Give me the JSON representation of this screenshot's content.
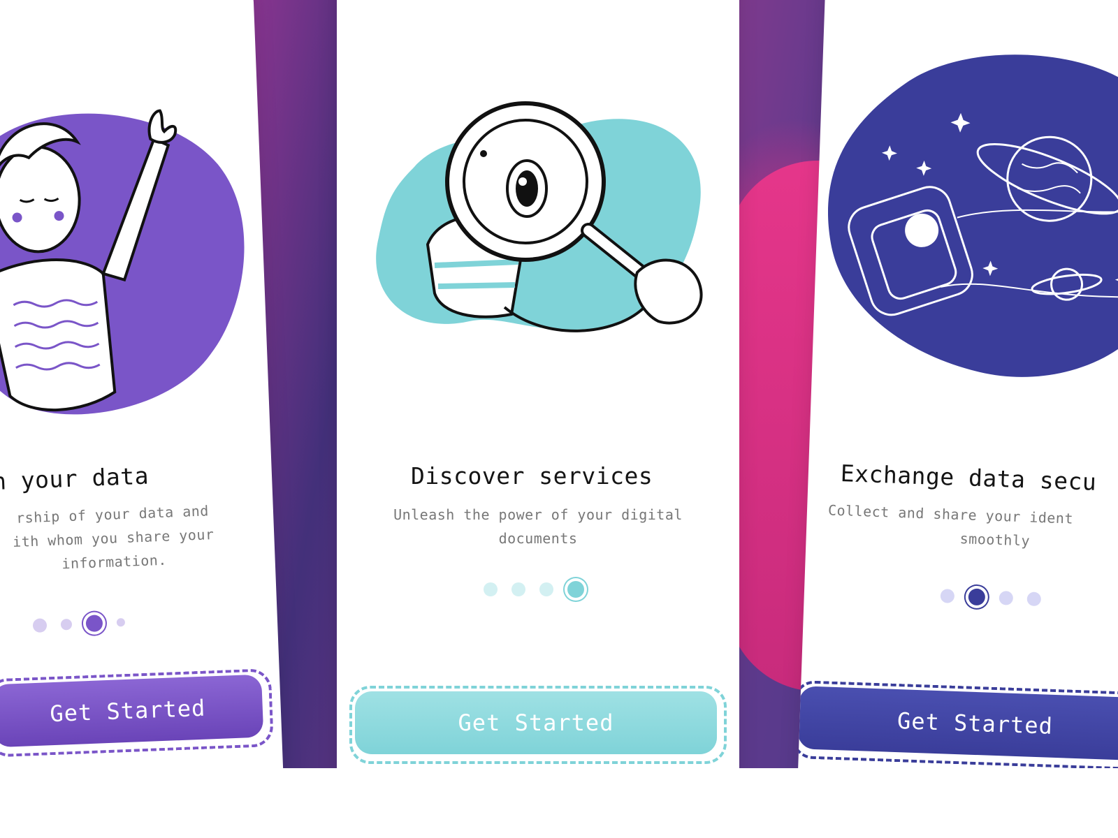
{
  "colors": {
    "purple": "#7a55c8",
    "teal": "#7fd3d8",
    "navy": "#3a3d9a",
    "pink": "#e0307f"
  },
  "screens": [
    {
      "title": "n your data",
      "subtitle_lines": [
        "rship of your data and",
        "ith whom you share your",
        "information."
      ],
      "button": "Get Started",
      "active_dot": 3,
      "dot_count": 4,
      "illustration": "waving-person"
    },
    {
      "title": "Discover services",
      "subtitle_lines": [
        "Unleash the power of your digital",
        "documents"
      ],
      "button": "Get Started",
      "active_dot": 4,
      "dot_count": 4,
      "illustration": "magnifying-glass"
    },
    {
      "title": "Exchange data secu",
      "subtitle_lines": [
        "Collect and share your ident",
        "smoothly"
      ],
      "button": "Get Started",
      "active_dot": 2,
      "dot_count": 4,
      "illustration": "smartwatch-planets"
    }
  ]
}
